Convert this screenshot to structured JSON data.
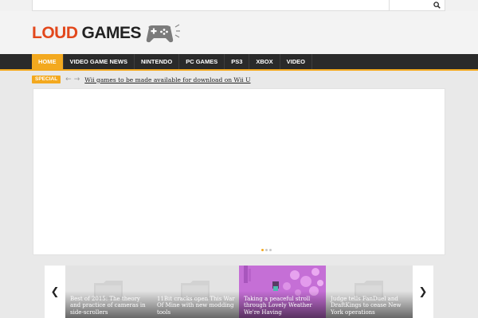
{
  "brand": {
    "word1": "LOUD",
    "word2": "GAMES"
  },
  "nav": {
    "items": [
      {
        "label": "HOME",
        "active": true
      },
      {
        "label": "VIDEO GAME NEWS"
      },
      {
        "label": "NINTENDO"
      },
      {
        "label": "PC GAMES"
      },
      {
        "label": "PS3"
      },
      {
        "label": "XBOX"
      },
      {
        "label": "VIDEO"
      }
    ]
  },
  "ticker": {
    "label": "SPECIAL",
    "headline": "Wii games to be made available for download on Wii U"
  },
  "slider": {
    "dots": 3,
    "active_dot": 1
  },
  "carousel": {
    "cards": [
      {
        "title": "Best of 2015: The theory and practice of cameras in side-scrollers"
      },
      {
        "title": "11Bit cracks open This War Of Mine with new modding tools"
      },
      {
        "title": "Taking a peaceful stroll through Lovely Weather We're Having"
      },
      {
        "title": "Judge tells FanDuel and DraftKings to cease New York operations"
      }
    ]
  },
  "icons": [
    "search-icon",
    "gamepad-icon",
    "arrow-left-icon",
    "arrow-right-icon",
    "chevron-left-icon",
    "chevron-right-icon",
    "image-placeholder-icon"
  ],
  "colors": {
    "accent": "#f3a91f",
    "logo_red": "#e2481c",
    "nav_bg": "#2a2a2a",
    "card_purple": "#c36fd4"
  }
}
